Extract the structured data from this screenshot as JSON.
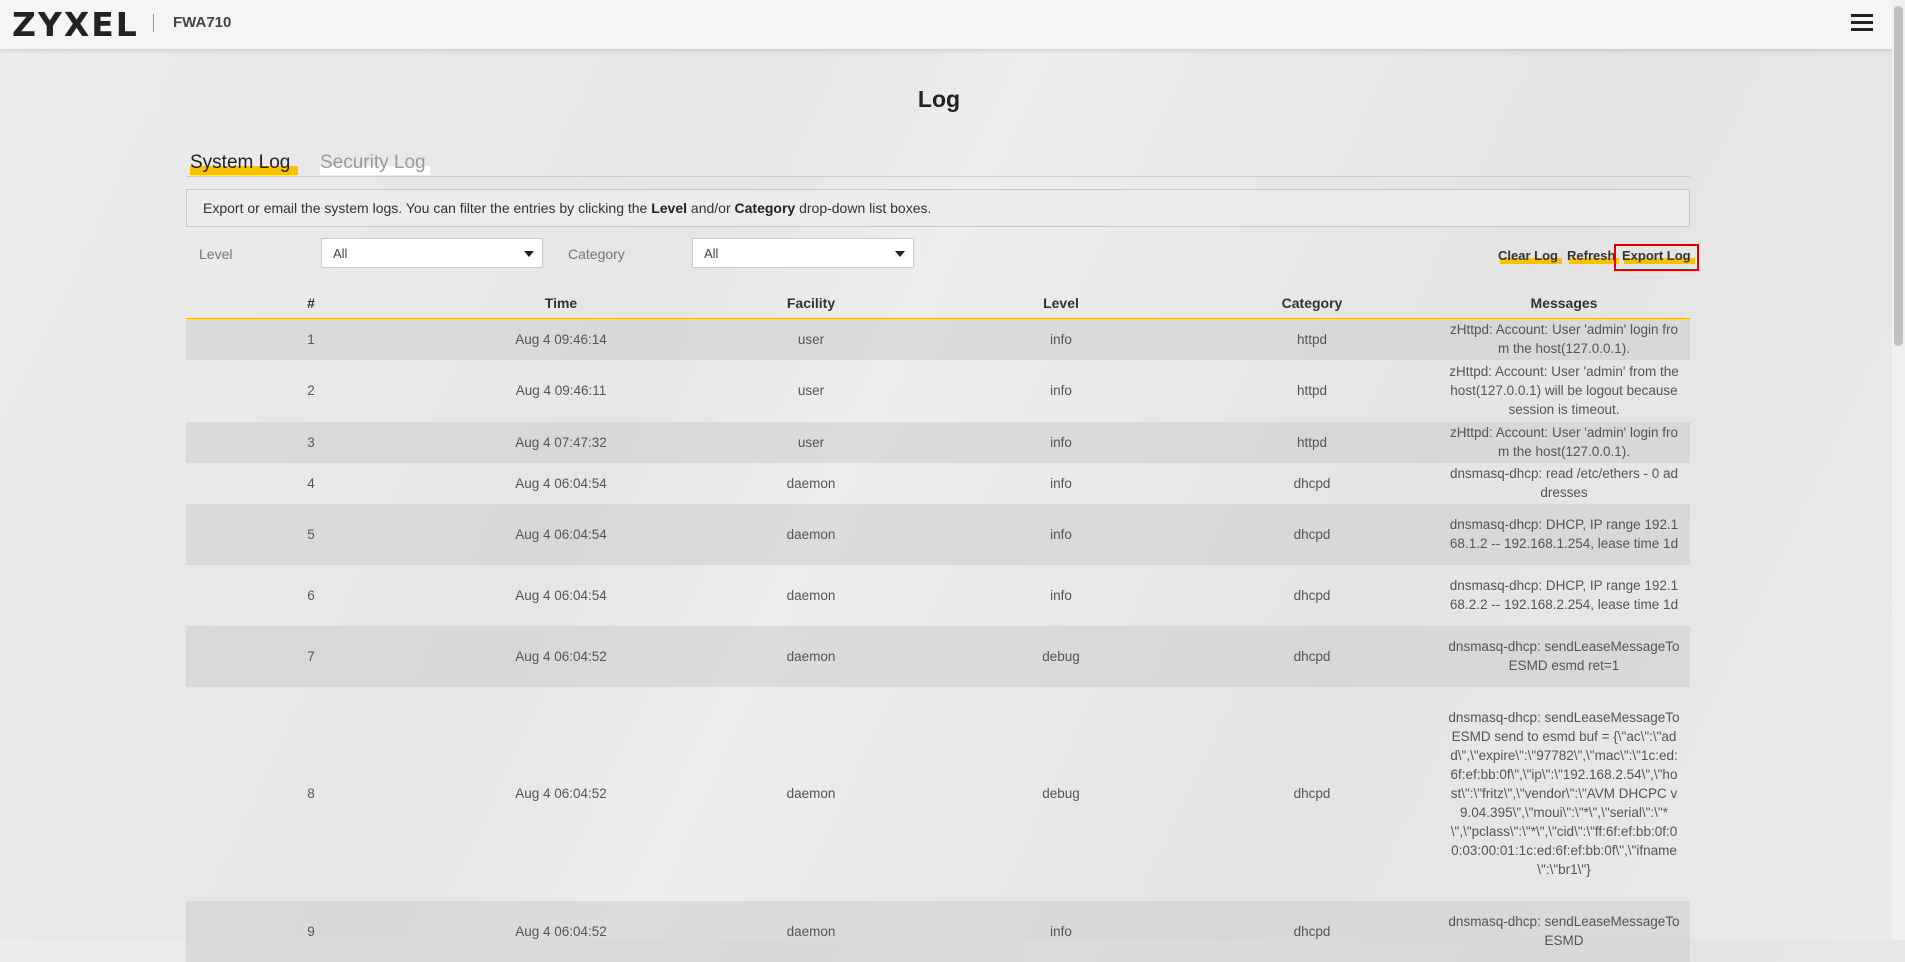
{
  "header": {
    "logo_text": "ZYXEL",
    "model": "FWA710",
    "menu_icon": "hamburger-menu-icon"
  },
  "page": {
    "title": "Log"
  },
  "tabs": [
    {
      "label": "System Log",
      "active": true
    },
    {
      "label": "Security Log",
      "active": false
    }
  ],
  "info": {
    "text_1": "Export or email the system logs. You can filter the entries by clicking the ",
    "bold_1": "Level",
    "text_2": " and/or ",
    "bold_2": "Category",
    "text_3": " drop-down list boxes."
  },
  "filters": {
    "level_label": "Level",
    "level_value": "All",
    "category_label": "Category",
    "category_value": "All"
  },
  "actions": {
    "clear": "Clear Log",
    "refresh": "Refresh",
    "export": "Export Log"
  },
  "table": {
    "headers": [
      "#",
      "Time",
      "Facility",
      "Level",
      "Category",
      "Messages"
    ],
    "rows": [
      {
        "num": "1",
        "time": "Aug 4 09:46:14",
        "facility": "user",
        "level": "info",
        "category": "httpd",
        "message": "zHttpd: Account: User 'admin' login from the host(127.0.0.1)."
      },
      {
        "num": "2",
        "time": "Aug 4 09:46:11",
        "facility": "user",
        "level": "info",
        "category": "httpd",
        "message": "zHttpd: Account: User 'admin' from the host(127.0.0.1) will be logout because session is timeout."
      },
      {
        "num": "3",
        "time": "Aug 4 07:47:32",
        "facility": "user",
        "level": "info",
        "category": "httpd",
        "message": "zHttpd: Account: User 'admin' login from the host(127.0.0.1)."
      },
      {
        "num": "4",
        "time": "Aug 4 06:04:54",
        "facility": "daemon",
        "level": "info",
        "category": "dhcpd",
        "message": "dnsmasq-dhcp: read /etc/ethers - 0 addresses"
      },
      {
        "num": "5",
        "time": "Aug 4 06:04:54",
        "facility": "daemon",
        "level": "info",
        "category": "dhcpd",
        "message": "dnsmasq-dhcp: DHCP, IP range 192.168.1.2 -- 192.168.1.254, lease time 1d"
      },
      {
        "num": "6",
        "time": "Aug 4 06:04:54",
        "facility": "daemon",
        "level": "info",
        "category": "dhcpd",
        "message": "dnsmasq-dhcp: DHCP, IP range 192.168.2.2 -- 192.168.2.254, lease time 1d"
      },
      {
        "num": "7",
        "time": "Aug 4 06:04:52",
        "facility": "daemon",
        "level": "debug",
        "category": "dhcpd",
        "message": "dnsmasq-dhcp: sendLeaseMessageToESMD esmd ret=1"
      },
      {
        "num": "8",
        "time": "Aug 4 06:04:52",
        "facility": "daemon",
        "level": "debug",
        "category": "dhcpd",
        "message": "dnsmasq-dhcp: sendLeaseMessageToESMD send to esmd buf = {\\\"ac\\\":\\\"add\\\",\\\"expire\\\":\\\"97782\\\",\\\"mac\\\":\\\"1c:ed:6f:ef:bb:0f\\\",\\\"ip\\\":\\\"192.168.2.54\\\",\\\"host\\\":\\\"fritz\\\",\\\"vendor\\\":\\\"AVM DHCPC v9.04.395\\\",\\\"moui\\\":\\\"*\\\",\\\"serial\\\":\\\"*\\\",\\\"pclass\\\":\\\"*\\\",\\\"cid\\\":\\\"ff:6f:ef:bb:0f:00:03:00:01:1c:ed:6f:ef:bb:0f\\\",\\\"ifname\\\":\\\"br1\\\"}"
      },
      {
        "num": "9",
        "time": "Aug 4 06:04:52",
        "facility": "daemon",
        "level": "info",
        "category": "dhcpd",
        "message": "dnsmasq-dhcp: sendLeaseMessageToESMD"
      }
    ]
  }
}
